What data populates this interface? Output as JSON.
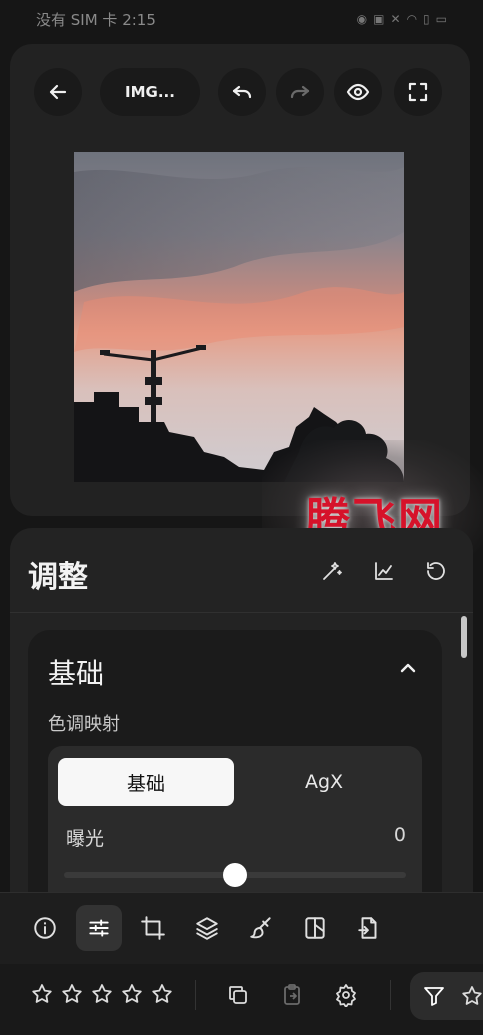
{
  "status_bar": {
    "carrier_time": "没有 SIM 卡 2:15"
  },
  "toolbar": {
    "file_name": "IMG..."
  },
  "watermark": {
    "text": "腾飞网"
  },
  "adjust": {
    "title": "调整",
    "section_title": "基础",
    "tone_mapping_label": "色调映射",
    "segments": [
      "基础",
      "AgX"
    ],
    "exposure_label": "曝光",
    "exposure_value": "0",
    "exposure_level": 0.5
  },
  "colors": {
    "background": "#161616",
    "card": "#222222",
    "accent_white": "#ffffff",
    "watermark_red": "#d6122a"
  },
  "icons": {
    "toolbar": [
      "back-arrow-icon",
      "undo-icon",
      "redo-icon",
      "eye-icon",
      "fullscreen-icon"
    ],
    "adjust_actions": [
      "magic-wand-icon",
      "histogram-icon",
      "reset-icon"
    ],
    "bottom_nav": [
      "info-icon",
      "sliders-icon",
      "crop-icon",
      "layers-icon",
      "brush-icon",
      "mask-icon",
      "export-icon"
    ],
    "bottom_bar": [
      "star-icon",
      "copy-icon",
      "paste-icon",
      "settings-icon",
      "filter-icon"
    ]
  },
  "rating": {
    "stars_filled": 0,
    "stars_total": 5
  }
}
